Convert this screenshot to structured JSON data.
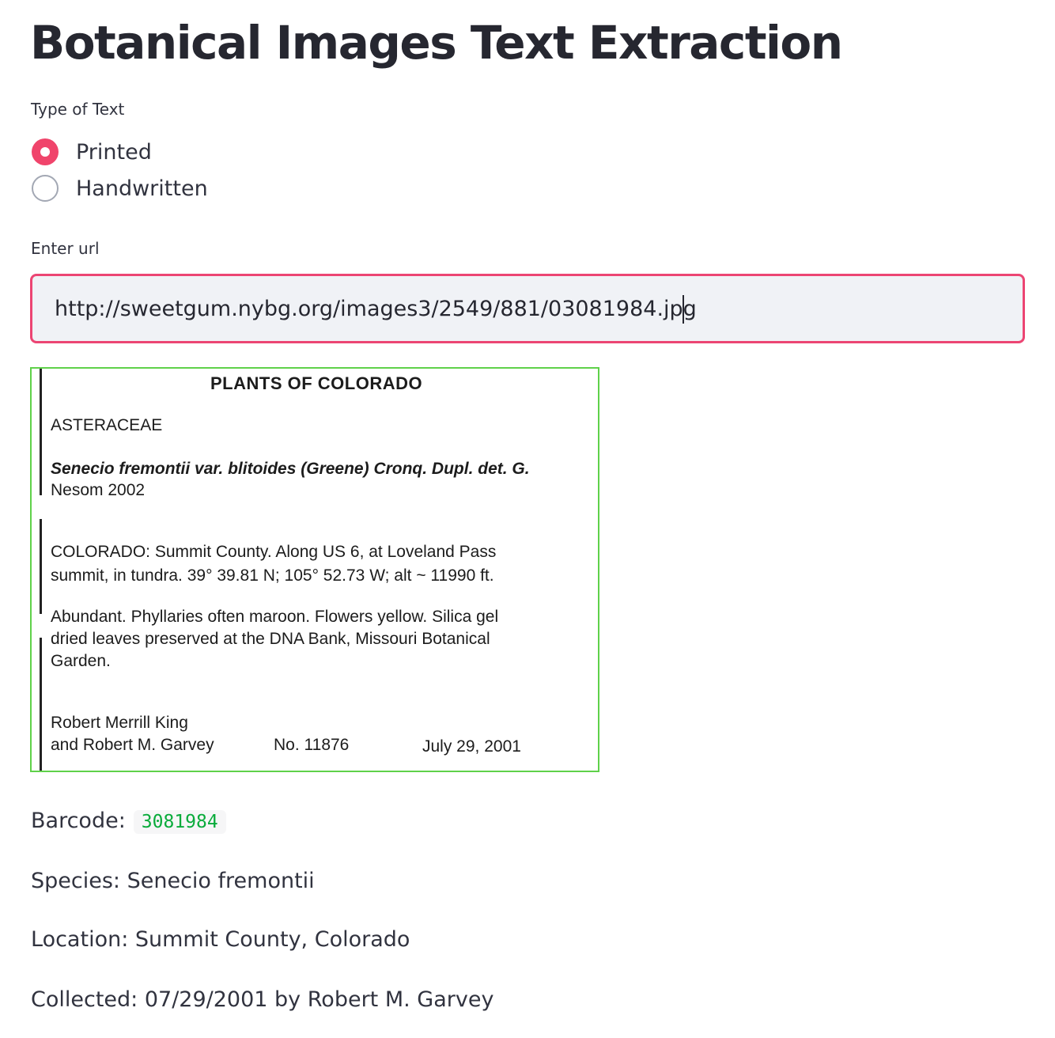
{
  "page": {
    "title": "Botanical Images Text Extraction"
  },
  "text_type": {
    "label": "Type of Text",
    "options": [
      {
        "label": "Printed",
        "selected": true
      },
      {
        "label": "Handwritten",
        "selected": false
      }
    ]
  },
  "url_input": {
    "label": "Enter url",
    "value": "http://sweetgum.nybg.org/images3/2549/881/03081984.jpg"
  },
  "specimen_label": {
    "heading": "PLANTS OF COLORADO",
    "family": "ASTERACEAE",
    "taxon_line_1": "Senecio fremontii var. blitoides (Greene) Cronq.   Dupl. det. G.",
    "taxon_line_2": "Nesom 2002",
    "locality_line_1": "COLORADO:  Summit County.  Along US 6, at Loveland Pass",
    "locality_line_2": "summit, in tundra.  39° 39.81 N;  105° 52.73 W;  alt ~ 11990 ft.",
    "habitat_line_1": "Abundant.  Phyllaries often maroon.  Flowers yellow.  Silica gel",
    "habitat_line_2": "dried leaves preserved at the DNA Bank, Missouri Botanical",
    "habitat_line_3": "Garden.",
    "collector_line_1": "Robert Merrill King",
    "collector_line_2": "and Robert M. Garvey",
    "number": "No. 11876",
    "date": "July 29, 2001"
  },
  "results": {
    "barcode_label": "Barcode:",
    "barcode_value": "3081984",
    "species": "Species: Senecio fremontii",
    "location": "Location: Summit County, Colorado",
    "collected": "Collected: 07/29/2001 by Robert M. Garvey"
  },
  "colors": {
    "accent": "#f0446b",
    "input_border": "#ec4573",
    "image_border": "#5fd14a",
    "code_text": "#09ab3b"
  }
}
